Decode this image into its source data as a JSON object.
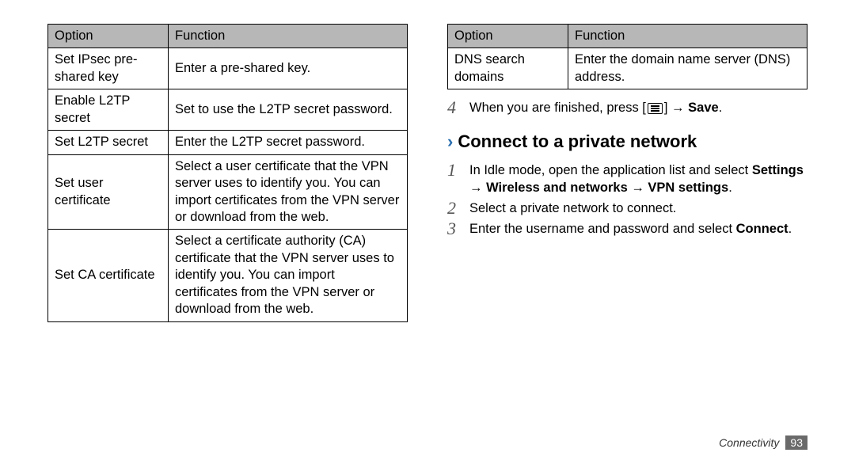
{
  "left_table": {
    "headers": [
      "Option",
      "Function"
    ],
    "rows": [
      {
        "option": "Set IPsec pre-shared key",
        "function": "Enter a pre-shared key."
      },
      {
        "option": "Enable L2TP secret",
        "function": "Set to use the L2TP secret password."
      },
      {
        "option": "Set L2TP secret",
        "function": "Enter the L2TP secret password."
      },
      {
        "option": "Set user certificate",
        "function": "Select a user certificate that the VPN server uses to identify you. You can import certificates from the VPN server or download from the web."
      },
      {
        "option": "Set CA certificate",
        "function": "Select a certificate authority (CA) certificate that the VPN server uses to identify you. You can import certificates from the VPN server or download from the web."
      }
    ]
  },
  "right_table": {
    "headers": [
      "Option",
      "Function"
    ],
    "rows": [
      {
        "option": "DNS search domains",
        "function": "Enter the domain name server (DNS) address."
      }
    ]
  },
  "step4": {
    "num": "4",
    "pre": "When you are finished, press [",
    "post": "] → ",
    "bold": "Save",
    "end": "."
  },
  "heading": "Connect to a private network",
  "stepsB": [
    {
      "num": "1",
      "pre": "In Idle mode, open the application list and select ",
      "bold": "Settings → Wireless and networks → VPN settings",
      "post": "."
    },
    {
      "num": "2",
      "pre": "Select a private network to connect.",
      "bold": "",
      "post": ""
    },
    {
      "num": "3",
      "pre": "Enter the username and password and select ",
      "bold": "Connect",
      "post": "."
    }
  ],
  "footer": {
    "section": "Connectivity",
    "page": "93"
  }
}
